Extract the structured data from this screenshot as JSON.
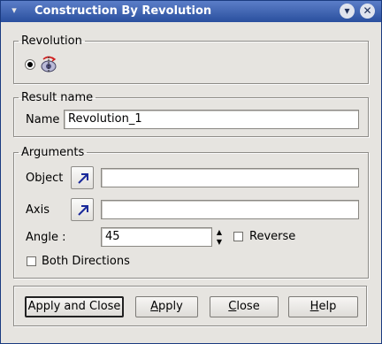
{
  "window": {
    "title": "Construction By Revolution",
    "menu_icon": "window-menu-icon",
    "minimize_icon": "minimize-icon",
    "close_icon": "close-icon"
  },
  "revolution_group": {
    "title": "Revolution",
    "option_icon": "revolution-icon",
    "selected": true
  },
  "result_group": {
    "title": "Result name",
    "name_label": "Name",
    "name_value": "Revolution_1"
  },
  "arguments_group": {
    "title": "Arguments",
    "object_label": "Object",
    "object_value": "",
    "axis_label": "Axis",
    "axis_value": "",
    "angle_label": "Angle :",
    "angle_value": "45",
    "reverse_label": "Reverse",
    "reverse_checked": false,
    "both_directions_label": "Both Directions",
    "both_directions_checked": false,
    "select_icon": "select-arrow-icon"
  },
  "buttons": {
    "apply_close": "Apply and Close",
    "apply_first": "A",
    "apply_rest": "pply",
    "close_first": "C",
    "close_rest": "lose",
    "help_first": "H",
    "help_rest": "elp"
  }
}
